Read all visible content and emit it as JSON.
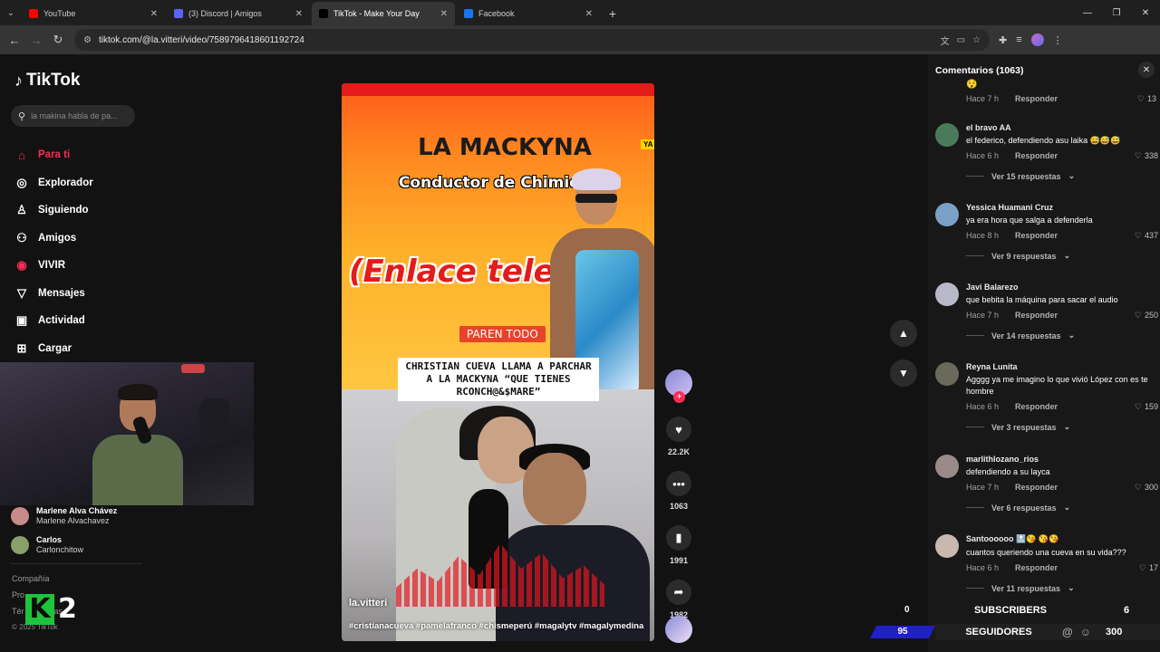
{
  "browser": {
    "tabs": [
      {
        "title": "YouTube",
        "color": "#ff0000",
        "active": false
      },
      {
        "title": "(3) Discord | Amigos",
        "color": "#5865f2",
        "active": false
      },
      {
        "title": "TikTok - Make Your Day",
        "color": "#000000",
        "active": true
      },
      {
        "title": "Facebook",
        "color": "#1877f2",
        "active": false
      }
    ],
    "url": "tiktok.com/@la.vitteri/video/7589796418601192724"
  },
  "sidebar": {
    "logo": "TikTok",
    "search_placeholder": "la makina habla de pa...",
    "nav": [
      {
        "label": "Para ti",
        "icon": "home-icon",
        "glyph": "⌂",
        "active": true
      },
      {
        "label": "Explorador",
        "icon": "compass-icon",
        "glyph": "◎",
        "active": false
      },
      {
        "label": "Siguiendo",
        "icon": "following-icon",
        "glyph": "♙",
        "active": false
      },
      {
        "label": "Amigos",
        "icon": "friends-icon",
        "glyph": "⚇",
        "active": false
      },
      {
        "label": "VIVIR",
        "icon": "live-icon",
        "glyph": "◉",
        "active": false
      },
      {
        "label": "Mensajes",
        "icon": "messages-icon",
        "glyph": "▽",
        "active": false
      },
      {
        "label": "Actividad",
        "icon": "activity-icon",
        "glyph": "▣",
        "active": false
      },
      {
        "label": "Cargar",
        "icon": "upload-icon",
        "glyph": "⊞",
        "active": false
      }
    ],
    "following": [
      {
        "name": "Marlene Alva Chávez",
        "handle": "Marlene Alvachavez",
        "color": "#c98a8a"
      },
      {
        "name": "Carlos",
        "handle": "Carlonchitow",
        "color": "#8aa06a"
      }
    ],
    "footer": [
      "Compañía",
      "Pro",
      "Tér",
      "y políticas"
    ],
    "copyright": "© 2025 TikTok"
  },
  "overlay_logo": {
    "letter": "K",
    "digit": "2"
  },
  "video": {
    "title": "LA MACKYNA",
    "subtitle": "Conductor de Chimic",
    "subtitle_end": "i",
    "big_text": "(Enlace tele",
    "side_tag": "YA",
    "badge": "PAREN TODO",
    "caption": "CHRISTIAN CUEVA LLAMA A PARCHAR A LA MACKYNA “QUE TIENES RCONCH@&$MARE”",
    "author": "la.vitteri",
    "hashtags": "#cristianacueva #pamelafranco #chismeperú #magalytv #magalymedina"
  },
  "actions": {
    "likes": "22.2K",
    "comments": "1063",
    "saves": "1991",
    "shares": "1982"
  },
  "comments": {
    "header": "Comentarios (1063)",
    "first": {
      "emoji": "😯",
      "time": "Hace 7 h",
      "reply": "Responder",
      "likes": "13"
    },
    "items": [
      {
        "name": "el bravo AA",
        "text": "el federico, defendiendo asu laika 😅😅😅",
        "time": "Hace 6 h",
        "likes": "338",
        "replies": "Ver 15 respuestas",
        "color": "#4a7a5a"
      },
      {
        "name": "Yessica Huamani Cruz",
        "text": "ya era hora que salga a defenderla",
        "time": "Hace 8 h",
        "likes": "437",
        "replies": "Ver 9 respuestas",
        "color": "#7aa0c8"
      },
      {
        "name": "Javi Balarezo",
        "text": "que bebita la máquina para sacar el audio",
        "time": "Hace 7 h",
        "likes": "250",
        "replies": "Ver 14 respuestas",
        "color": "#b8b8c8"
      },
      {
        "name": "Reyna Lunita",
        "text": "Agggg ya me imagino lo que vivió López con es te hombre",
        "time": "Hace 6 h",
        "likes": "159",
        "replies": "Ver 3 respuestas",
        "color": "#6a6a5a"
      },
      {
        "name": "marlithlozano_rios",
        "text": "defendiendo a su layca",
        "time": "Hace 7 h",
        "likes": "300",
        "replies": "Ver 6 respuestas",
        "color": "#9a8a8a"
      },
      {
        "name": "Santoooooo 🔝😘 😘😘",
        "text": "cuantos queriendo una cueva en su vida???",
        "time": "Hace 6 h",
        "likes": "17",
        "replies": "Ver 11 respuestas",
        "color": "#c8b8b0"
      }
    ],
    "reply_label": "Responder"
  },
  "stream": {
    "zero": "0",
    "subscribers_label": "SUBSCRIBERS",
    "subscribers_value": "6",
    "blue_value": "95",
    "followers_label": "SEGUIDORES",
    "followers_value": "300"
  }
}
